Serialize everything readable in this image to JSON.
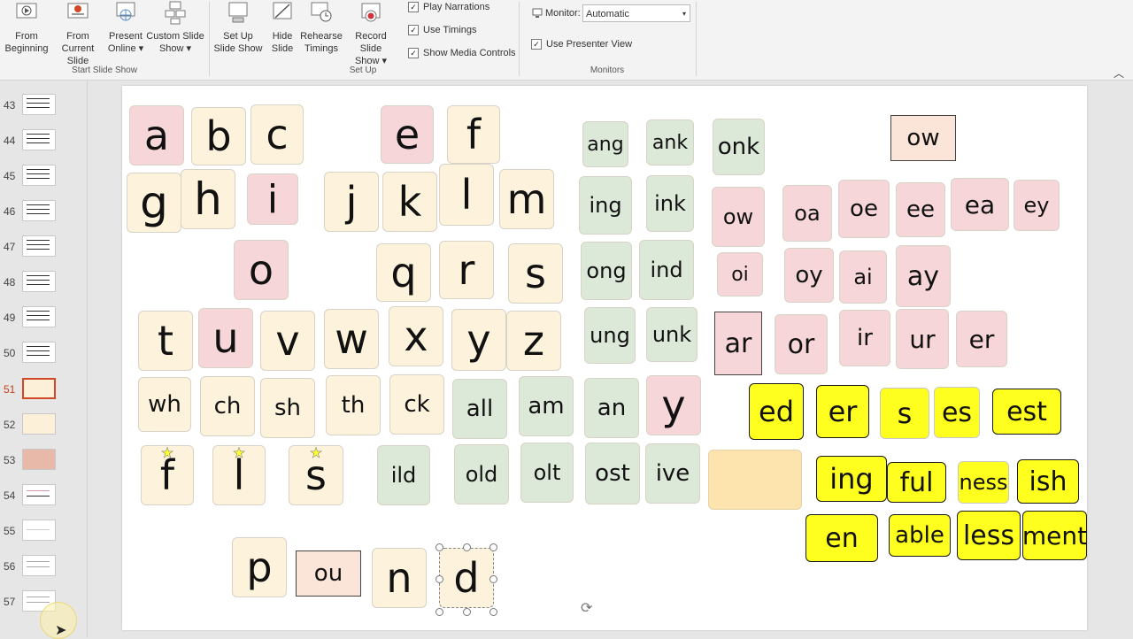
{
  "ribbon": {
    "groups": {
      "start": {
        "label": "Start Slide Show",
        "buttons": [
          {
            "label1": "From",
            "label2": "Beginning",
            "icon": "play-from-beginning-icon"
          },
          {
            "label1": "From",
            "label2": "Current Slide",
            "icon": "play-current-icon"
          },
          {
            "label1": "Present",
            "label2": "Online ▾",
            "icon": "present-online-icon"
          },
          {
            "label1": "Custom Slide",
            "label2": "Show ▾",
            "icon": "custom-show-icon"
          }
        ]
      },
      "setup": {
        "label": "Set Up",
        "buttons": [
          {
            "label1": "Set Up",
            "label2": "Slide Show",
            "icon": "setup-show-icon"
          },
          {
            "label1": "Hide",
            "label2": "Slide",
            "icon": "hide-slide-icon"
          },
          {
            "label1": "Rehearse",
            "label2": "Timings",
            "icon": "rehearse-timings-icon"
          },
          {
            "label1": "Record Slide",
            "label2": "Show ▾",
            "icon": "record-show-icon"
          }
        ],
        "checks": [
          {
            "label": "Play Narrations",
            "checked": true
          },
          {
            "label": "Use Timings",
            "checked": true
          },
          {
            "label": "Show Media Controls",
            "checked": true
          }
        ]
      },
      "monitors": {
        "label": "Monitors",
        "monitor_label": "Monitor:",
        "monitor_value": "Automatic",
        "presenter_view": "Use Presenter View"
      }
    }
  },
  "thumbnails": {
    "numbers": [
      "43",
      "44",
      "45",
      "46",
      "47",
      "48",
      "49",
      "50",
      "51",
      "52",
      "53",
      "54",
      "55",
      "56",
      "57"
    ],
    "selected": "51"
  },
  "slide": {
    "tiles": {
      "a": "a",
      "b": "b",
      "c": "c",
      "e": "e",
      "f": "f",
      "g": "g",
      "h": "h",
      "i": "i",
      "j": "j",
      "k": "k",
      "l": "l",
      "m": "m",
      "o": "o",
      "q": "q",
      "r": "r",
      "s": "s",
      "t": "t",
      "u": "u",
      "v": "v",
      "w": "w",
      "x": "x",
      "y": "y",
      "z": "z",
      "wh": "wh",
      "ch": "ch",
      "sh": "sh",
      "th": "th",
      "ck": "ck",
      "all": "all",
      "am": "am",
      "an": "an",
      "y2": "y",
      "f2": "f",
      "l2": "l",
      "s2": "s",
      "ild": "ild",
      "old": "old",
      "olt": "olt",
      "ost": "ost",
      "ive": "ive",
      "p": "p",
      "ou": "ou",
      "n": "n",
      "d": "d",
      "ang": "ang",
      "ank": "ank",
      "onk": "onk",
      "ing": "ing",
      "ink": "ink",
      "ong": "ong",
      "ind": "ind",
      "ung": "ung",
      "unk": "unk",
      "ow_top": "ow",
      "ow": "ow",
      "oa": "oa",
      "oe": "oe",
      "ee": "ee",
      "ea": "ea",
      "ey": "ey",
      "oi": "oi",
      "oy": "oy",
      "ai": "ai",
      "ay": "ay",
      "ar": "ar",
      "or": "or",
      "ir": "ir",
      "ur": "ur",
      "er": "er",
      "s_ed": "ed",
      "s_er": "er",
      "s_s": "s",
      "s_es": "es",
      "s_est": "est",
      "s_ing": "ing",
      "s_ful": "ful",
      "s_ness": "ness",
      "s_ish": "ish",
      "s_en": "en",
      "s_able": "able",
      "s_less": "less",
      "s_ment": "ment"
    }
  }
}
